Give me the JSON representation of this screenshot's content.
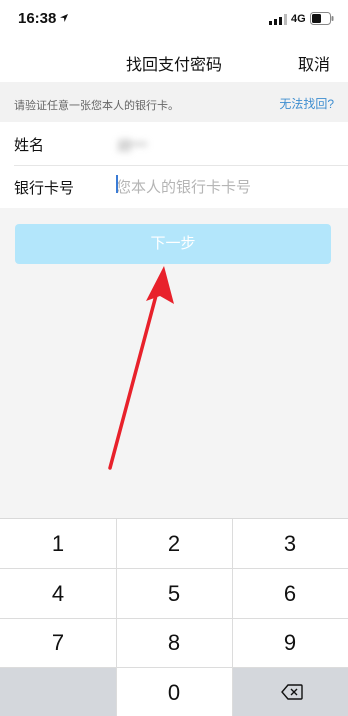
{
  "status_bar": {
    "time": "16:38",
    "network": "4G"
  },
  "nav": {
    "title": "找回支付密码",
    "cancel_label": "取消"
  },
  "hint": {
    "text": "请验证任意一张您本人的银行卡。",
    "link": "无法找回?"
  },
  "form": {
    "name_label": "姓名",
    "name_value": "胡***",
    "card_label": "银行卡号",
    "card_placeholder": "您本人的银行卡卡号",
    "card_value": ""
  },
  "next_button": "下一步",
  "keypad": {
    "keys": [
      "1",
      "2",
      "3",
      "4",
      "5",
      "6",
      "7",
      "8",
      "9",
      "0"
    ]
  },
  "colors": {
    "accent_link": "#3e8ed0",
    "next_button_disabled": "#b3e6fb",
    "annotation_arrow": "#e8212b"
  }
}
